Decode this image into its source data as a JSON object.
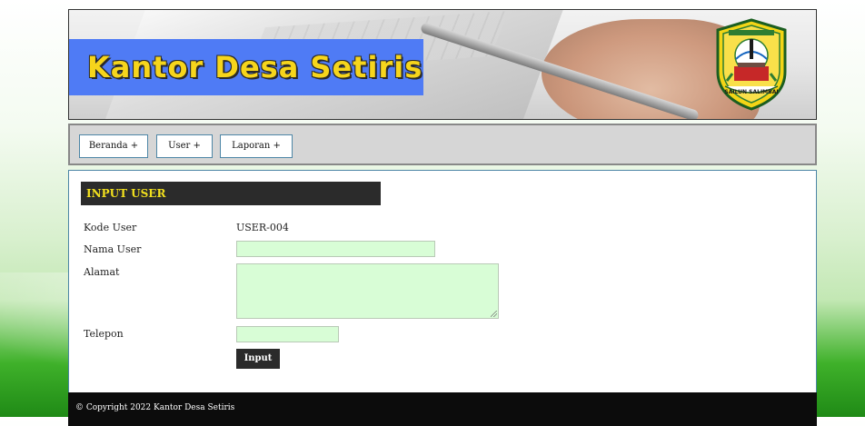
{
  "header": {
    "site_title": "Kantor Desa Setiris",
    "logo": {
      "icon": "regency-emblem-icon",
      "motto": "SAILUN SALIMBAI"
    }
  },
  "nav": {
    "items": [
      {
        "label": "Beranda +"
      },
      {
        "label": "User +"
      },
      {
        "label": "Laporan +"
      }
    ]
  },
  "form": {
    "heading": "INPUT USER",
    "fields": {
      "kode": {
        "label": "Kode User",
        "value": "USER-004"
      },
      "nama": {
        "label": "Nama User",
        "value": ""
      },
      "alamat": {
        "label": "Alamat",
        "value": ""
      },
      "telepon": {
        "label": "Telepon",
        "value": ""
      }
    },
    "submit_label": "Input"
  },
  "footer": {
    "copyright": "© Copyright 2022 Kantor Desa Setiris"
  },
  "colors": {
    "title_yellow": "#f6d51c",
    "title_box_blue": "#4f7bf5",
    "input_green": "#d8fdd6",
    "dark": "#2b2b2b",
    "border_blue": "#4d86a6"
  }
}
